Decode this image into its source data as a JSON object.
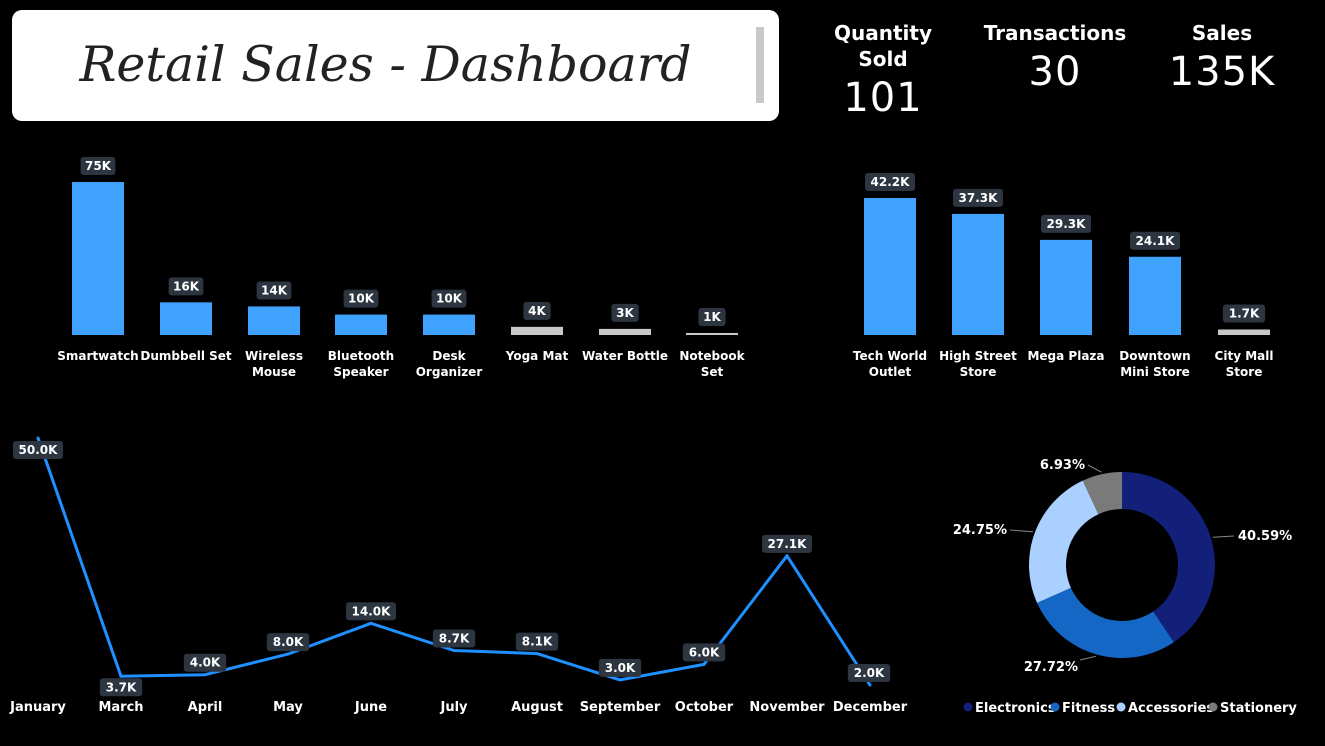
{
  "header": {
    "title": "Retail Sales - Dashboard"
  },
  "kpis": [
    {
      "label": "Quantity Sold",
      "value": "101"
    },
    {
      "label": "Transactions",
      "value": "30"
    },
    {
      "label": "Sales",
      "value": "135K"
    }
  ],
  "chart_data": [
    {
      "type": "bar",
      "categories": [
        "Smartwatch",
        "Dumbbell Set",
        "Wireless Mouse",
        "Bluetooth Speaker",
        "Desk Organizer",
        "Yoga Mat",
        "Water Bottle",
        "Notebook Set"
      ],
      "category_lines": [
        [
          "Smartwatch"
        ],
        [
          "Dumbbell Set"
        ],
        [
          "Wireless",
          "Mouse"
        ],
        [
          "Bluetooth",
          "Speaker"
        ],
        [
          "Desk",
          "Organizer"
        ],
        [
          "Yoga Mat"
        ],
        [
          "Water Bottle"
        ],
        [
          "Notebook",
          "Set"
        ]
      ],
      "values": [
        75,
        16,
        14,
        10,
        10,
        4,
        3,
        1
      ],
      "data_labels": [
        "75K",
        "16K",
        "14K",
        "10K",
        "10K",
        "4K",
        "3K",
        "1K"
      ],
      "bar_colors": [
        "#3fa2ff",
        "#3fa2ff",
        "#3fa2ff",
        "#3fa2ff",
        "#3fa2ff",
        "#c8c8c8",
        "#c8c8c8",
        "#c8c8c8"
      ],
      "unit": "K"
    },
    {
      "type": "bar",
      "categories": [
        "Tech World Outlet",
        "High Street Store",
        "Mega Plaza",
        "Downtown Mini Store",
        "City Mall Store"
      ],
      "category_lines": [
        [
          "Tech World",
          "Outlet"
        ],
        [
          "High Street",
          "Store"
        ],
        [
          "Mega Plaza"
        ],
        [
          "Downtown",
          "Mini Store"
        ],
        [
          "City Mall",
          "Store"
        ]
      ],
      "values": [
        42.2,
        37.3,
        29.3,
        24.1,
        1.7
      ],
      "data_labels": [
        "42.2K",
        "37.3K",
        "29.3K",
        "24.1K",
        "1.7K"
      ],
      "bar_colors": [
        "#3fa2ff",
        "#3fa2ff",
        "#3fa2ff",
        "#3fa2ff",
        "#c8c8c8"
      ],
      "unit": "K"
    },
    {
      "type": "line",
      "categories": [
        "January",
        "March",
        "April",
        "May",
        "June",
        "July",
        "August",
        "September",
        "October",
        "November",
        "December"
      ],
      "values": [
        50.0,
        3.7,
        4.0,
        8.0,
        14.0,
        8.7,
        8.1,
        3.0,
        6.0,
        27.1,
        2.0
      ],
      "data_labels": [
        "50.0K",
        "3.7K",
        "4.0K",
        "8.0K",
        "14.0K",
        "8.7K",
        "8.1K",
        "3.0K",
        "6.0K",
        "27.1K",
        "2.0K"
      ],
      "line_color": "#1e90ff",
      "unit": "K"
    },
    {
      "type": "pie",
      "donut": true,
      "categories": [
        "Electronics",
        "Fitness",
        "Accessories",
        "Stationery"
      ],
      "values": [
        40.59,
        27.72,
        24.75,
        6.93
      ],
      "data_labels": [
        "40.59%",
        "27.72%",
        "24.75%",
        "6.93%"
      ],
      "colors": [
        "#12207a",
        "#1467c4",
        "#a9d0ff",
        "#7a7a7a"
      ],
      "legend_position": "bottom"
    }
  ]
}
